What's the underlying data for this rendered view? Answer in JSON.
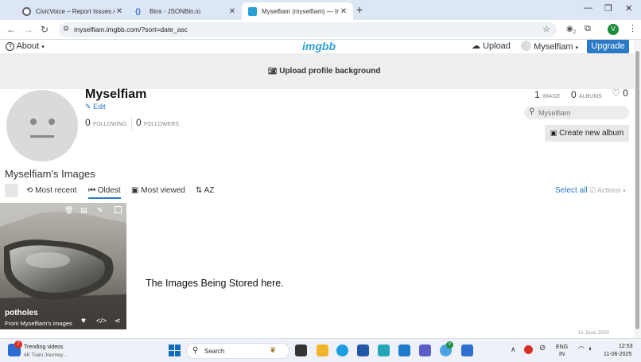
{
  "browser": {
    "tabs": [
      {
        "title": "CivicVoice – Report Issues Anon",
        "favicon_color": "#5f6368",
        "active": false
      },
      {
        "title": "Bins - JSONBin.io",
        "favicon_color": "#3d6ee0",
        "active": false
      },
      {
        "title": "Myselfiam (myselfiam) — ImgBB",
        "favicon_color": "#2a9fd6",
        "active": true
      }
    ],
    "url": "myselfiam.imgbb.com/?sort=date_asc",
    "profile_initial": "V",
    "profile_color": "#1e8e3e",
    "extension_badge": "2"
  },
  "header": {
    "about_label": "About",
    "logo_text": "imgbb",
    "upload_label": "Upload",
    "user_label": "Myselfiam",
    "upgrade_label": "Upgrade",
    "accent_color": "#2a7ac7"
  },
  "banner": {
    "label": "Upload profile background"
  },
  "profile": {
    "name": "Myselfiam",
    "edit_label": "Edit",
    "following_count": "0",
    "following_label": "FOLLOWING",
    "followers_count": "0",
    "followers_label": "FOLLOWERS",
    "image_count": "1",
    "image_label": "IMAGE",
    "album_count": "0",
    "album_label": "ALBUMS",
    "likes_count": "0",
    "search_placeholder": "Myselfiam",
    "create_album_label": "Create new album"
  },
  "images": {
    "section_title": "Myselfiam's Images",
    "sort_options": [
      "Most recent",
      "Oldest",
      "Most viewed",
      "AZ"
    ],
    "active_sort": "Oldest",
    "select_all_label": "Select all",
    "actions_label": "Actions",
    "items": [
      {
        "title": "potholes",
        "subtitle": "From Myselfiam's images"
      }
    ],
    "empty_note": "The Images Being Stored here."
  },
  "notification": {
    "text": "11 June 2025"
  },
  "taskbar": {
    "weather_title": "Trending videos",
    "weather_sub": "4K Train Journey...",
    "weather_badge": "7",
    "search_label": "Search",
    "lang_top": "ENG",
    "lang_bottom": "IN",
    "time": "12:53",
    "date": "11-06-2025",
    "chrome_badge": "V"
  }
}
